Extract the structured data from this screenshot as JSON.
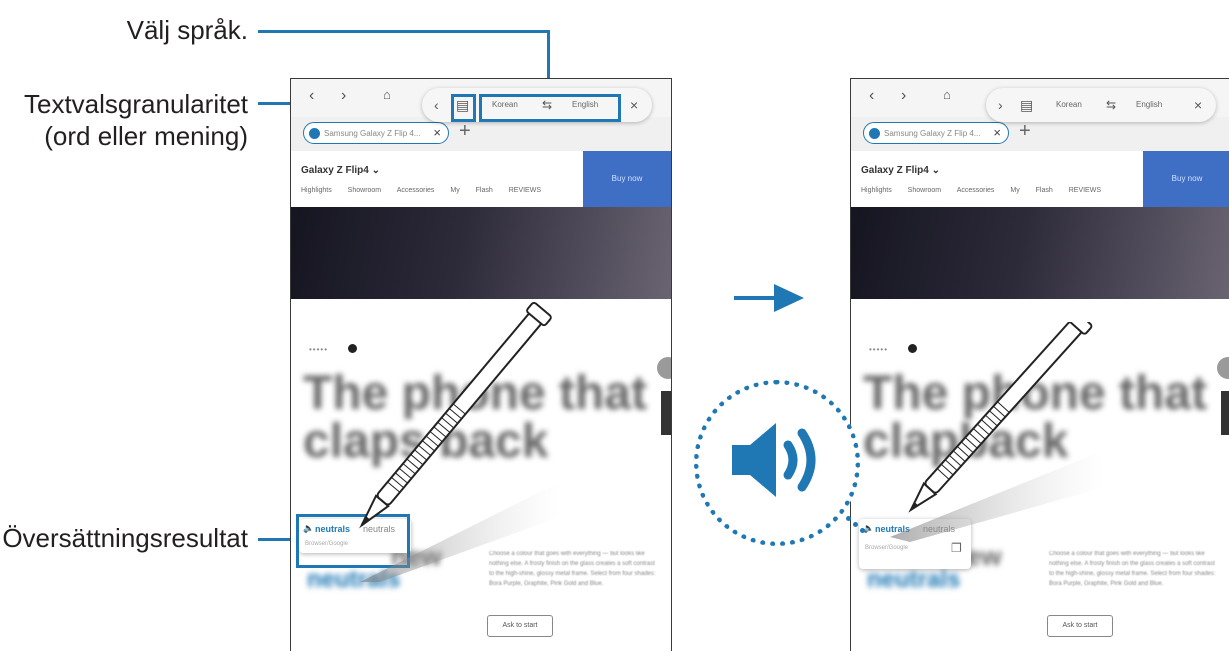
{
  "callouts": {
    "language": "Välj språk.",
    "granularity_line1": "Textvalsgranularitet",
    "granularity_line2": "(ord eller mening)",
    "result": "Översättningsresultat"
  },
  "browser": {
    "tab_label": "Samsung Galaxy Z Flip 4...",
    "product_title": "Galaxy Z Flip4",
    "buy_label": "Buy now",
    "subnav": "Highlights Showroom Accessories My Flash REVIEWS",
    "headline_line1": "The phone that",
    "headline_line2_left": "claps back",
    "headline_line2_right": "clapback",
    "new_word": "new",
    "neutrals_word": "neutrals",
    "description": "Choose a colour that goes with everything — but looks like nothing else. A frosty finish on the glass creates a soft contrast to the high-shine, glossy metal frame. Select from four shades: Bora Purple, Graphite, Pink Gold and Blue.",
    "learn_more": "Ask to start"
  },
  "translation_bar": {
    "source_lang": "Korean",
    "target_lang": "English",
    "swap_icon": "swap-icon",
    "close_icon": "close-icon",
    "granularity_icon": "text-select-icon"
  },
  "translation_popup": {
    "word": "neutrals",
    "translation": "neutrals",
    "sub_text": "Browser/Google"
  },
  "colors": {
    "accent": "#1f78b4",
    "buy_button": "#3f6fc4"
  }
}
